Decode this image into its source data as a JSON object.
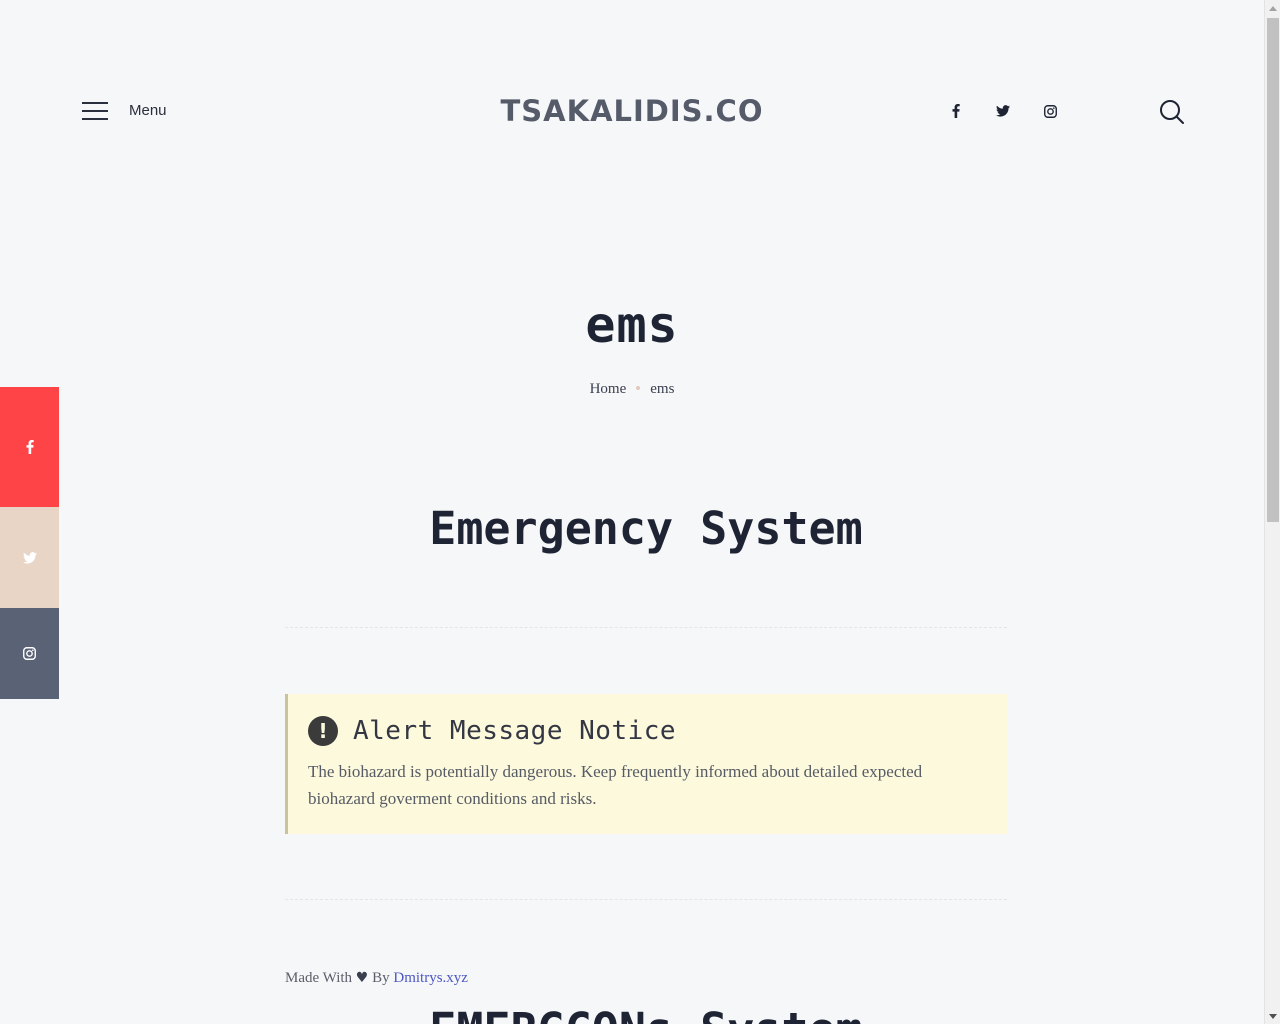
{
  "header": {
    "menu_label": "Menu",
    "logo": "TSAKALIDIS.CO"
  },
  "page": {
    "title": "ems",
    "breadcrumb": {
      "home": "Home",
      "current": "ems"
    }
  },
  "sections": [
    {
      "title": "Emergency System"
    },
    {
      "title": "EMERGCONs System"
    }
  ],
  "alert": {
    "title": "Alert Message Notice",
    "text": "The biohazard is potentially dangerous. Keep frequently informed about detailed expected biohazard goverment conditions and risks."
  },
  "credits": {
    "made_with": "Made With",
    "by": "By",
    "author": "Dmitrys.xyz"
  },
  "icons": {
    "header_social": [
      "facebook-icon",
      "twitter-icon",
      "instagram-icon"
    ],
    "side_share": [
      "facebook-icon",
      "twitter-icon",
      "instagram-icon"
    ]
  },
  "colors": {
    "share_facebook": "#ff4448",
    "share_twitter": "#e8d5c6",
    "share_instagram": "#5a6275",
    "alert_bg": "#fcf9dc",
    "link": "#4d57c2"
  }
}
